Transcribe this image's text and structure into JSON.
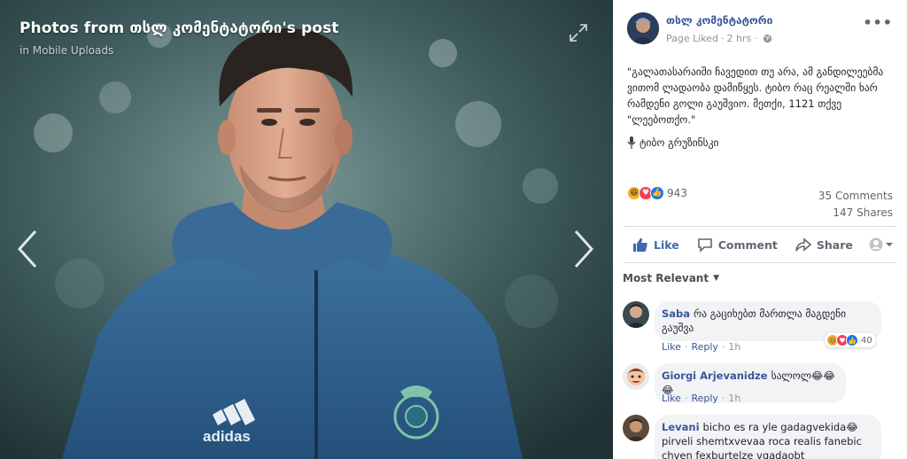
{
  "viewer": {
    "title": "Photos from თსლ კომენტატორი's post",
    "album": "in Mobile Uploads",
    "photo_text": {
      "kit_brand": "adidas"
    }
  },
  "post": {
    "page_name": "თსლ კომენტატორი",
    "liked_label": "Page Liked",
    "dot": "·",
    "time": "2 hrs",
    "dot2": "·",
    "text": "\"გალათასარაიში ჩავედით თუ არა, ამ განდილეებმა ვითომ ლადაობა დამიწყეს. ტიბო რაც რეალში ხარ რამდენი გოლი გაუშვიო. მეთქი, 1121 თქვე \"ლეებოთქო.\"",
    "signature": "ტიბო გრუზინსკი"
  },
  "stats": {
    "reaction_count": "943",
    "comments": "35 Comments",
    "shares": "147 Shares"
  },
  "actions": {
    "like": "Like",
    "comment": "Comment",
    "share": "Share"
  },
  "sort": {
    "label": "Most Relevant"
  },
  "comments": [
    {
      "author": "Saba",
      "text_line1": "რა გაციხებთ მართლა მაგდენი",
      "text_line2": "გაუშვა",
      "like": "Like",
      "sep": "·",
      "reply": "Reply",
      "sep2": "·",
      "time": "1h",
      "reaction_count": "40"
    },
    {
      "author": "Giorgi Arjevanidze",
      "text": "სალოლ😂😂😂",
      "like": "Like",
      "sep": "·",
      "reply": "Reply",
      "sep2": "·",
      "time": "1h"
    },
    {
      "author": "Levani",
      "text_line1": "bicho es ra yle gadagvekida😂",
      "text_line2": "pirveli shemtxvevaa roca realis fanebic",
      "text_line3": "chven fexburtelze vqadaobt"
    }
  ],
  "icons": {
    "expand": "expand-icon",
    "prev": "chevron-left-icon",
    "next": "chevron-right-icon",
    "globe": "globe-icon",
    "more": "more-icon",
    "mic": "microphone-icon",
    "like": "thumbs-up-icon",
    "comment": "speech-bubble-icon",
    "share": "share-arrow-icon",
    "view_as": "avatar-select-icon"
  },
  "colors": {
    "link": "#365899",
    "like_blue": "#4267b2",
    "secondary": "#606770",
    "bubble": "#f2f3f5"
  }
}
